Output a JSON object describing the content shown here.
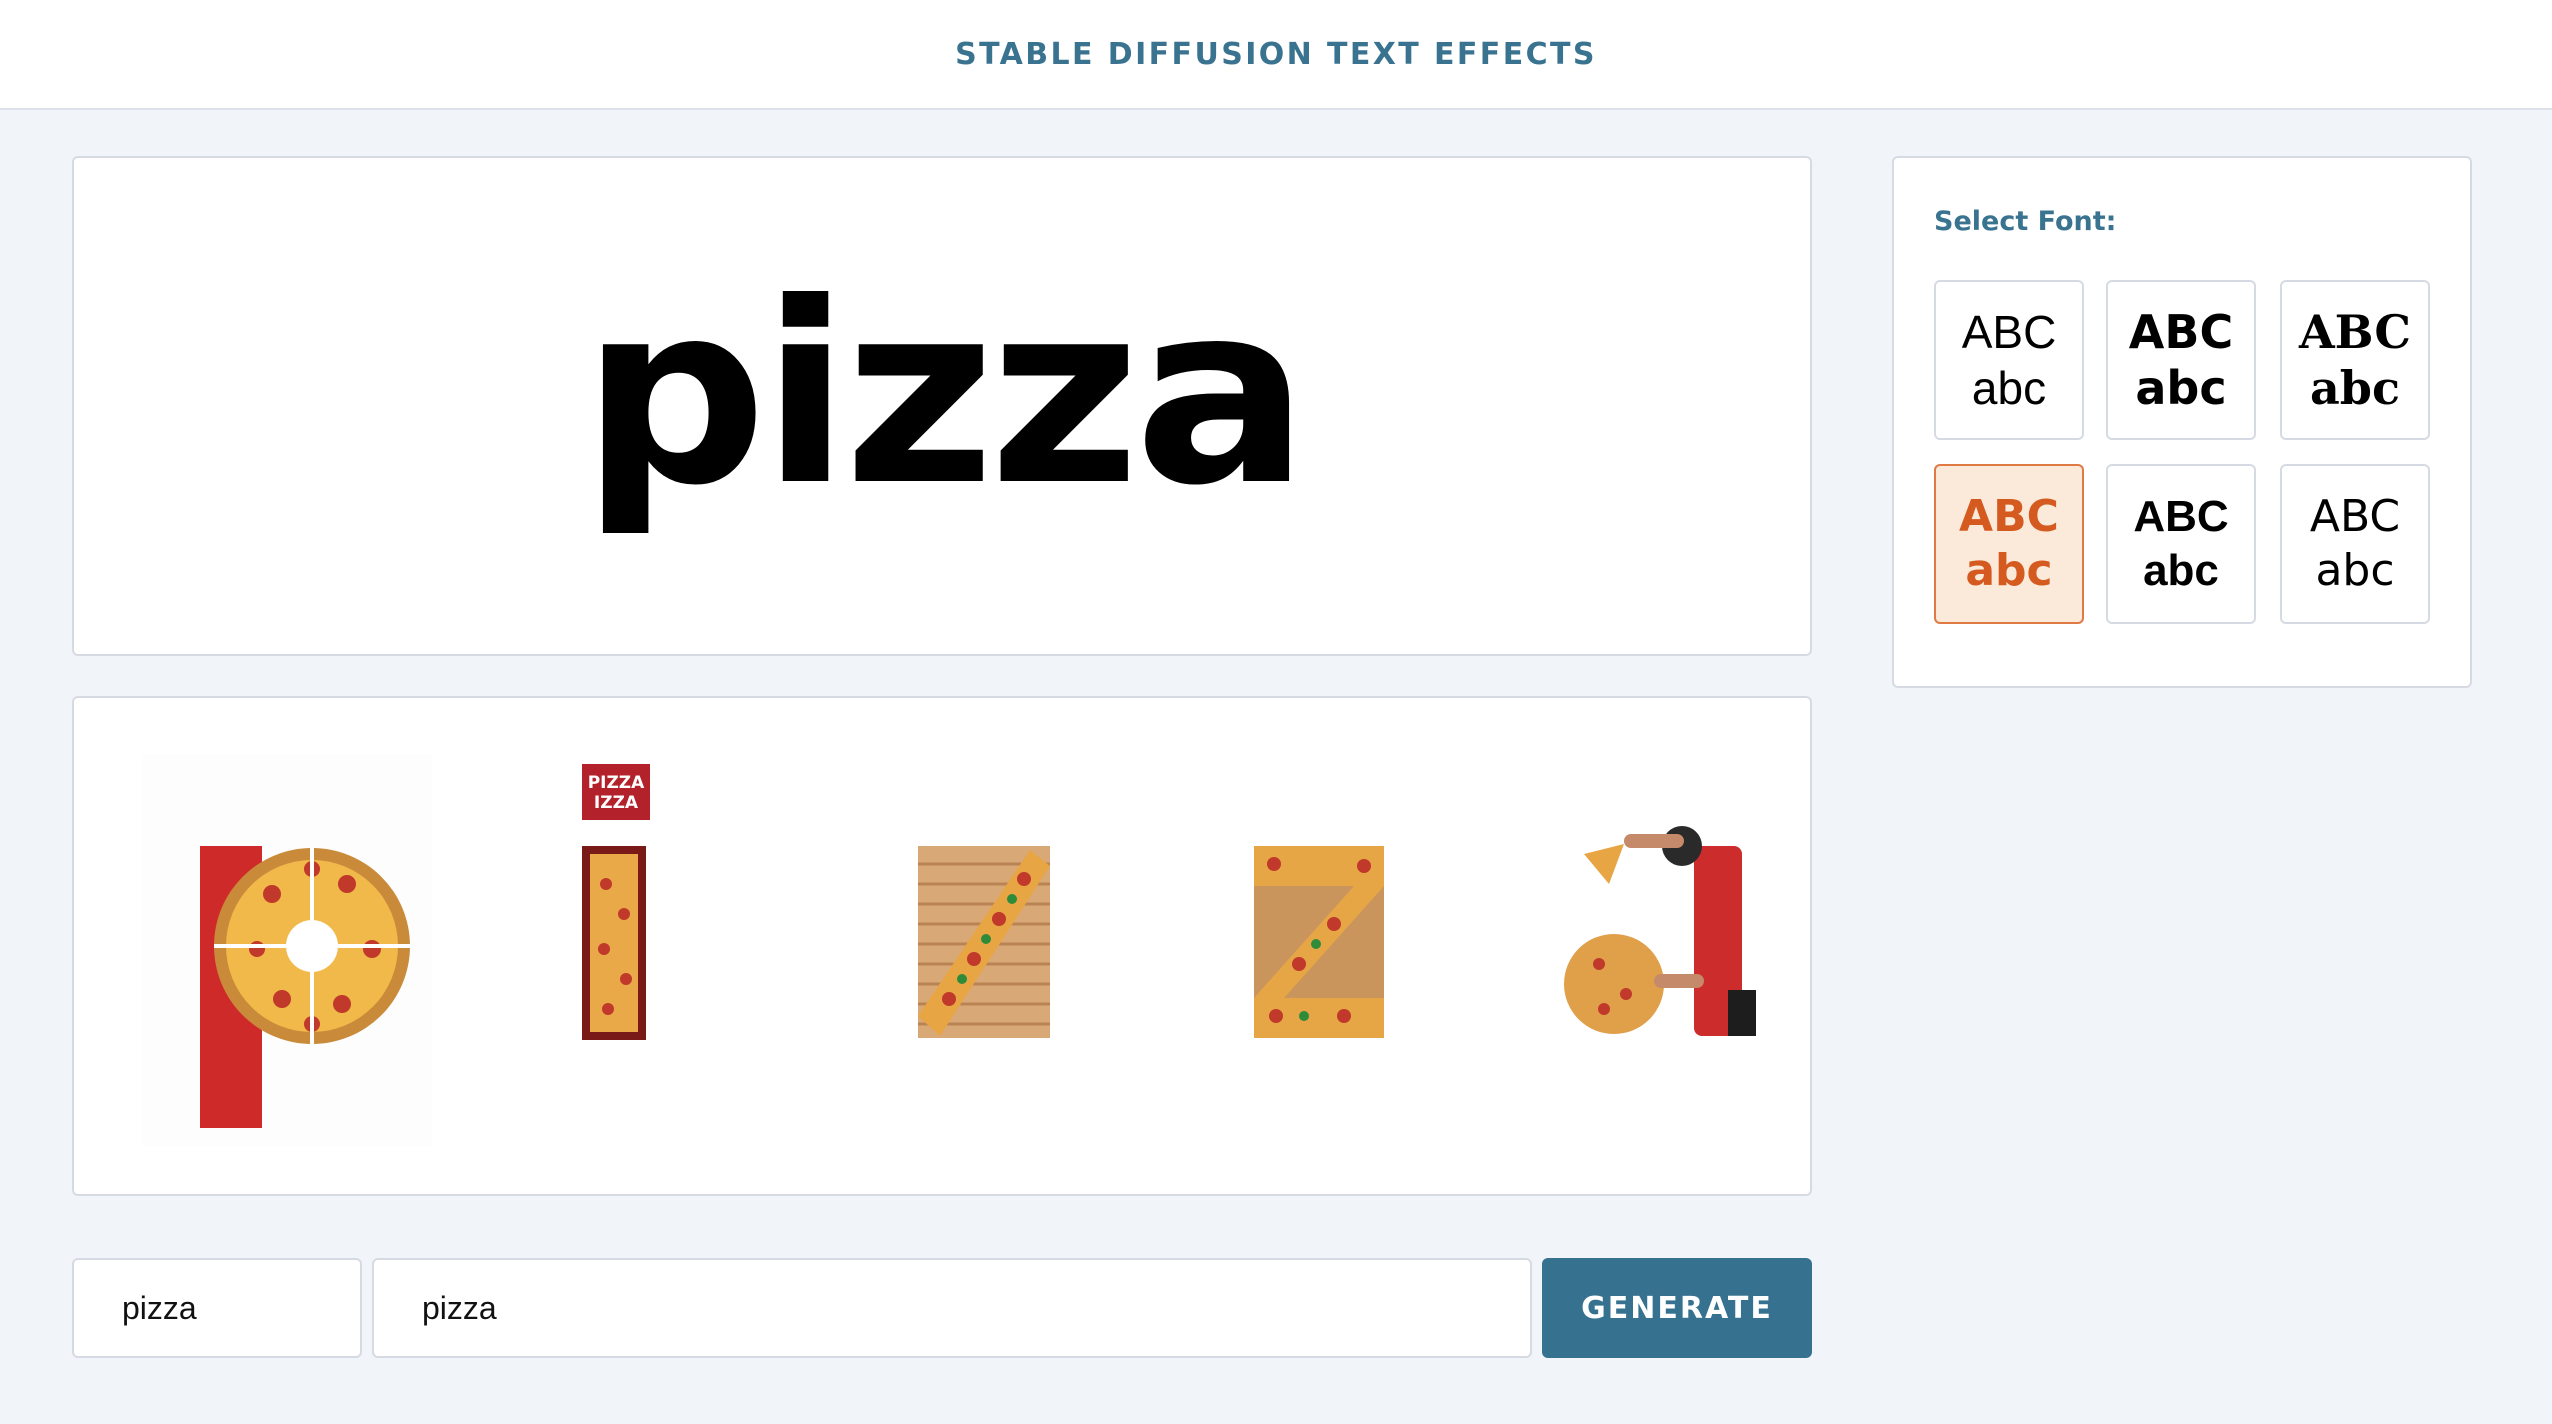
{
  "header": {
    "title": "STABLE DIFFUSION TEXT EFFECTS"
  },
  "preview": {
    "text": "pizza"
  },
  "results": {
    "letters": [
      "p",
      "i",
      "z",
      "z",
      "a"
    ],
    "sign_lines": [
      "PIZZA",
      "IZZA"
    ]
  },
  "font_panel": {
    "label": "Select Font:",
    "options": [
      {
        "upper": "ABC",
        "lower": "abc",
        "selected": false
      },
      {
        "upper": "ABC",
        "lower": "abc",
        "selected": false
      },
      {
        "upper": "ABC",
        "lower": "abc",
        "selected": false
      },
      {
        "upper": "ABC",
        "lower": "abc",
        "selected": true
      },
      {
        "upper": "ABC",
        "lower": "abc",
        "selected": false
      },
      {
        "upper": "ABC",
        "lower": "abc",
        "selected": false
      }
    ]
  },
  "form": {
    "word_value": "pizza",
    "prompt_value": "pizza",
    "generate_label": "GENERATE"
  },
  "colors": {
    "accent": "#36728f",
    "selected_bg": "#fbe9da",
    "selected_text": "#d45a20",
    "page_bg": "#f1f4f9"
  }
}
